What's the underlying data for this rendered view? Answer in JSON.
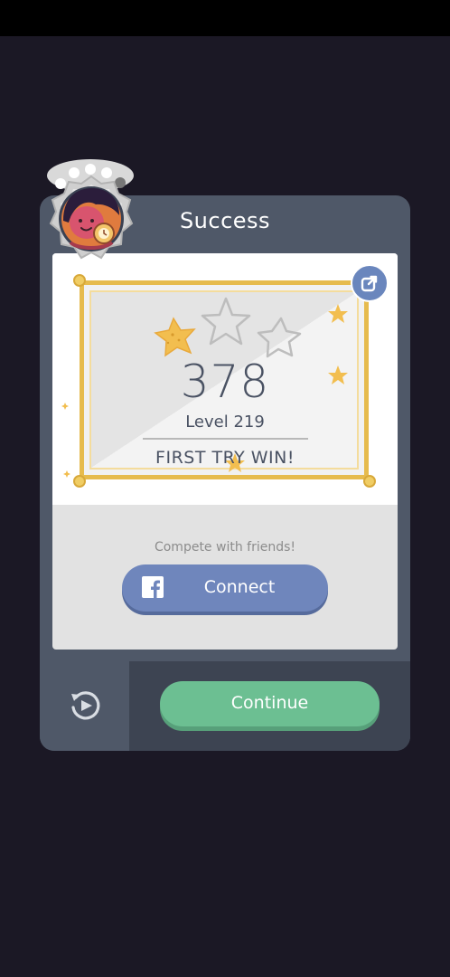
{
  "dialog": {
    "title": "Success"
  },
  "result": {
    "score": "378",
    "level": "Level 219",
    "first_try": "FIRST TRY WIN!",
    "stars_earned": 1,
    "stars_total": 3
  },
  "social": {
    "compete_text": "Compete with friends!",
    "connect_label": "Connect"
  },
  "actions": {
    "continue_label": "Continue"
  },
  "icons": {
    "share": "share-icon",
    "facebook": "facebook-icon",
    "replay": "replay-icon",
    "avatar": "avatar-icon"
  },
  "colors": {
    "background": "#1b1825",
    "dialog": "#4f5868",
    "frame_gold": "#e6bb4d",
    "star_gold": "#f2be4f",
    "connect_blue": "#6f86bc",
    "continue_green": "#6cbf92",
    "text_dark": "#4a5263"
  }
}
